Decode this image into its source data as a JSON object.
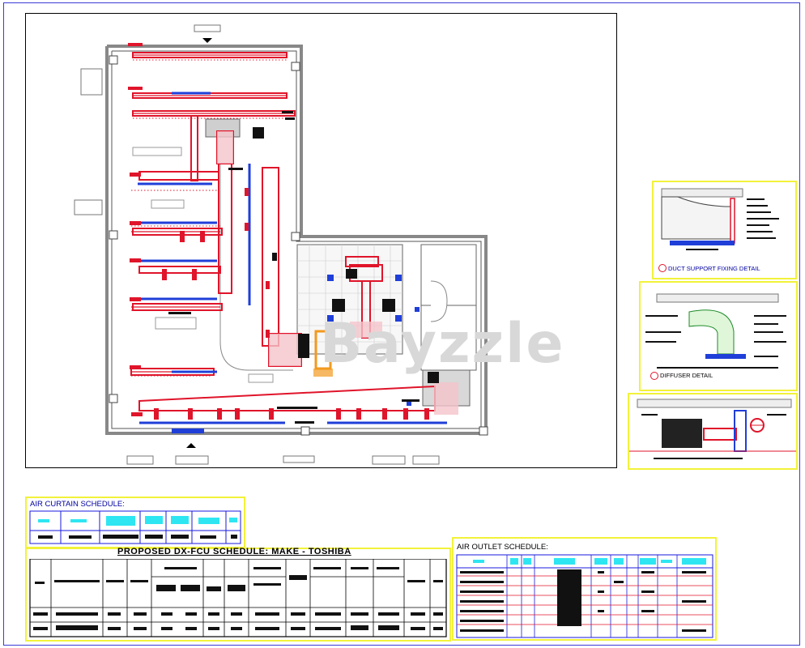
{
  "drawing": {
    "watermark": "Bayzzle",
    "colors": {
      "frame": "#3b3bd6",
      "duct": "#e0142a",
      "diffuser_blue": "#1f3fd8",
      "schedule_border": "#f2f23a",
      "table_grid": "#1a1adf",
      "header_cyan": "#2ee6f2",
      "orange": "#f29a1f"
    }
  },
  "details": {
    "duct_support": {
      "title": "DUCT SUPPORT FIXING DETAIL"
    },
    "diffuser": {
      "title": "DIFFUSER DETAIL"
    }
  },
  "schedules": {
    "air_curtain": {
      "title": "AIR CURTAIN SCHEDULE:"
    },
    "fcu": {
      "title": "PROPOSED  DX-FCU SCHEDULE: MAKE - TOSHIBA"
    },
    "air_outlet": {
      "title": "AIR OUTLET SCHEDULE:"
    }
  }
}
